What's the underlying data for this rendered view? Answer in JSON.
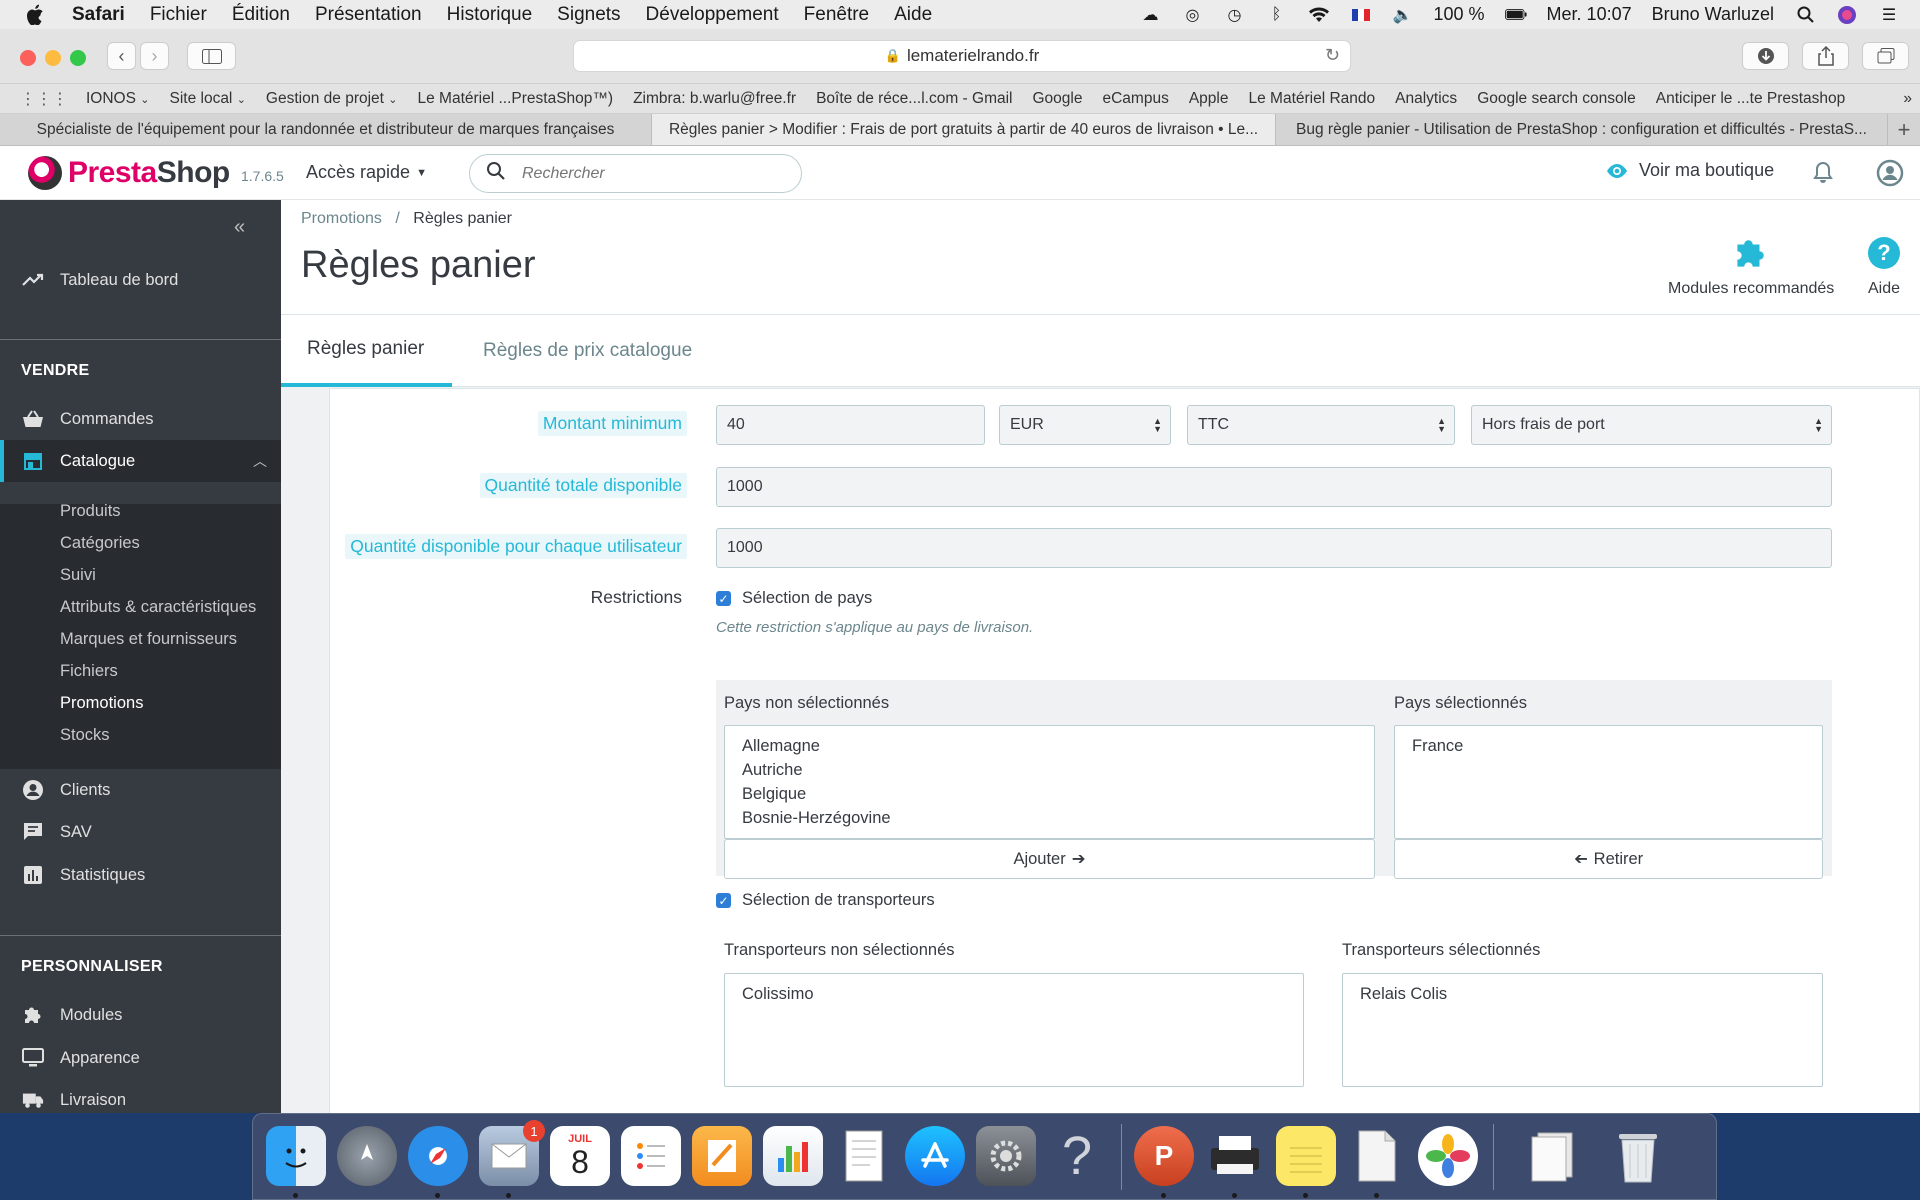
{
  "menubar": {
    "app": "Safari",
    "menus": [
      "Fichier",
      "Édition",
      "Présentation",
      "Historique",
      "Signets",
      "Développement",
      "Fenêtre",
      "Aide"
    ],
    "battery": "100 %",
    "clock": "Mer. 10:07",
    "user": "Bruno Warluzel"
  },
  "browser": {
    "url": "lematerielrando.fr",
    "bookmarks": [
      "IONOS",
      "Site local",
      "Gestion de projet",
      "Le Matériel ...PrestaShop™)",
      "Zimbra: b.warlu@free.fr",
      "Boîte de réce...l.com - Gmail",
      "Google",
      "eCampus",
      "Apple",
      "Le Matériel Rando",
      "Analytics",
      "Google search console",
      "Anticiper le ...te Prestashop"
    ],
    "tabs": [
      "Spécialiste de l'équipement pour la randonnée et distributeur de marques françaises",
      "Règles panier > Modifier : Frais de port gratuits à partir de 40 euros de livraison • Le...",
      "Bug règle panier - Utilisation de PrestaShop : configuration et difficultés - PrestaS..."
    ],
    "bookmark_overflow": "»"
  },
  "ps_header": {
    "logo_presta": "Presta",
    "logo_shop": "Shop",
    "version": "1.7.6.5",
    "quick_access": "Accès rapide",
    "search_placeholder": "Rechercher",
    "view_shop": "Voir ma boutique"
  },
  "sidebar": {
    "dashboard": "Tableau de bord",
    "section_sell": "VENDRE",
    "orders": "Commandes",
    "catalog": "Catalogue",
    "catalog_sub": [
      "Produits",
      "Catégories",
      "Suivi",
      "Attributs & caractéristiques",
      "Marques et fournisseurs",
      "Fichiers",
      "Promotions",
      "Stocks"
    ],
    "customers": "Clients",
    "sav": "SAV",
    "stats": "Statistiques",
    "section_customize": "PERSONNALISER",
    "modules": "Modules",
    "appearance": "Apparence",
    "shipping": "Livraison"
  },
  "page": {
    "breadcrumb_parent": "Promotions",
    "breadcrumb_sep": "/",
    "breadcrumb_current": "Règles panier",
    "title": "Règles panier",
    "tool_modules": "Modules recommandés",
    "tool_help": "Aide",
    "tabs": [
      "Règles panier",
      "Règles de prix catalogue"
    ]
  },
  "form": {
    "min_amount_label": "Montant minimum",
    "min_amount_value": "40",
    "currency": "EUR",
    "tax": "TTC",
    "shipping_mode": "Hors frais de port",
    "total_qty_label": "Quantité totale disponible",
    "total_qty_value": "1000",
    "per_user_label": "Quantité disponible pour chaque utilisateur",
    "per_user_value": "1000",
    "restrictions_label": "Restrictions",
    "country_check": "Sélection de pays",
    "country_hint": "Cette restriction s'applique au pays de livraison.",
    "countries_unselected_title": "Pays non sélectionnés",
    "countries_unselected": [
      "Allemagne",
      "Autriche",
      "Belgique",
      "Bosnie-Herzégovine"
    ],
    "countries_selected_title": "Pays sélectionnés",
    "countries_selected": [
      "France"
    ],
    "add_button": "Ajouter",
    "remove_button": "Retirer",
    "carrier_check": "Sélection de transporteurs",
    "carriers_unselected_title": "Transporteurs non sélectionnés",
    "carriers_unselected": [
      "Colissimo"
    ],
    "carriers_selected_title": "Transporteurs sélectionnés",
    "carriers_selected": [
      "Relais Colis"
    ]
  },
  "dock": {
    "calendar_month": "JUIL",
    "calendar_day": "8",
    "mail_badge": "1"
  },
  "colors": {
    "accent": "#25b9d7",
    "sidebar": "#363a41",
    "brand": "#df0067"
  }
}
